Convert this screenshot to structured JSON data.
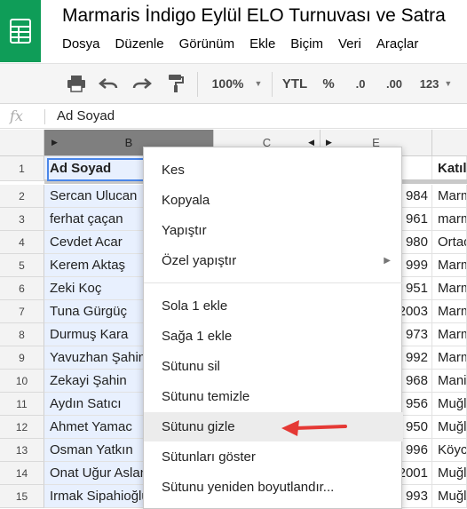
{
  "app": {
    "title": "Marmaris İndigo Eylül ELO Turnuvası ve Satra",
    "menu": [
      "Dosya",
      "Düzenle",
      "Görünüm",
      "Ekle",
      "Biçim",
      "Veri",
      "Araçlar"
    ]
  },
  "toolbar": {
    "icons": [
      "print-icon",
      "undo-icon",
      "redo-icon",
      "paint-format-icon"
    ],
    "zoom": "100%",
    "currency": "YTL",
    "percent": "%",
    "decimal_decrease": ".0",
    "decimal_increase": ".00",
    "more_formats": "123"
  },
  "formula_bar": {
    "fx": "fx",
    "value": "Ad Soyad"
  },
  "columns": [
    "B",
    "C",
    "E"
  ],
  "rows": [
    {
      "n": "1",
      "b": "Ad Soyad",
      "e": "",
      "f": "Katıl"
    },
    {
      "n": "2",
      "b": "Sercan Ulucan",
      "e": "984",
      "f": "Marm"
    },
    {
      "n": "3",
      "b": "ferhat çaçan",
      "e": "961",
      "f": "marm"
    },
    {
      "n": "4",
      "b": "Cevdet Acar",
      "e": "980",
      "f": "Ortac"
    },
    {
      "n": "5",
      "b": "Kerem Aktaş",
      "e": "999",
      "f": "Marm"
    },
    {
      "n": "6",
      "b": "Zeki Koç",
      "e": "951",
      "f": "Marm"
    },
    {
      "n": "7",
      "b": "Tuna Gürgüç",
      "e": "2003",
      "f": "Marm"
    },
    {
      "n": "8",
      "b": "Durmuş Kara",
      "e": "973",
      "f": "Marm"
    },
    {
      "n": "9",
      "b": "Yavuzhan Şahin",
      "e": "992",
      "f": "Marm"
    },
    {
      "n": "10",
      "b": "Zekayi Şahin",
      "e": "968",
      "f": "Mani"
    },
    {
      "n": "11",
      "b": "Aydın Satıcı",
      "e": "956",
      "f": "Muğl"
    },
    {
      "n": "12",
      "b": "Ahmet Yamac",
      "e": "950",
      "f": "Muğl"
    },
    {
      "n": "13",
      "b": "Osman Yatkın",
      "e": "996",
      "f": "Köyc"
    },
    {
      "n": "14",
      "b": "Onat Uğur Aslan",
      "e": "2001",
      "f": "Muğl"
    },
    {
      "n": "15",
      "b": "Irmak Sipahioğlu",
      "e": "993",
      "f": "Muğl"
    }
  ],
  "context_menu": {
    "group1": [
      "Kes",
      "Kopyala",
      "Yapıştır",
      "Özel yapıştır"
    ],
    "group2": [
      "Sola 1 ekle",
      "Sağa 1 ekle",
      "Sütunu sil",
      "Sütunu temizle",
      "Sütunu gizle",
      "Sütunları göster",
      "Sütunu yeniden boyutlandır..."
    ],
    "highlighted": "Sütunu gizle",
    "annotation_color": "#e53935"
  }
}
